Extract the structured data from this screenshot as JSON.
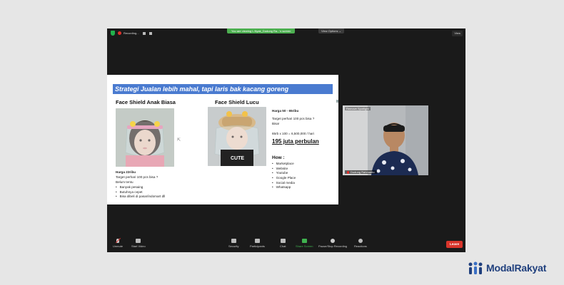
{
  "zoom": {
    "recording_label": "Recording...",
    "viewing_banner": "You are viewing L.Nyak_Dudung Ra...'s screen",
    "view_options": "View Options ⌄",
    "view_button": "View"
  },
  "slide": {
    "title": "Strategi Jualan lebih mahal, tapi laris bak kacang goreng",
    "left": {
      "heading": "Face Shield Anak Biasa",
      "price": "Harga 22ribu",
      "target": "Target perhari 100 pcs bisa ?",
      "status": "Belum tentu",
      "bullets": [
        "Banyak pesaing",
        "Butuhnya cepet",
        "Bisa dibeli di pasar/indomart dll"
      ]
    },
    "right": {
      "heading": "Face Shield Lucu",
      "price": "Harga 50 - 65ribu",
      "target": "Target perhari 100 pcs bisa ?",
      "status": "Bisa!",
      "calc": "65rb x 100 = 6,500,000 / hari",
      "monthly": "195 juta perbulan",
      "how_heading": "How :",
      "how_items": [
        "Marketplace",
        "Website",
        "Youtube",
        "Google Place",
        "Social media",
        "Whatsapp"
      ]
    }
  },
  "speaker": {
    "spotlight_label": "Remove Spotlight",
    "name": "Dudung Rahmanto"
  },
  "toolbar": {
    "unmute": "Unmute",
    "start_video": "Start Video",
    "security": "Security",
    "participants": "Participants",
    "participants_count": "66",
    "chat": "Chat",
    "share_screen": "Share Screen",
    "record": "Pause/Stop Recording",
    "reactions": "Reactions",
    "leave": "Leave"
  },
  "brand": {
    "name": "ModalRakyat",
    "color": "#1f3f7d"
  }
}
